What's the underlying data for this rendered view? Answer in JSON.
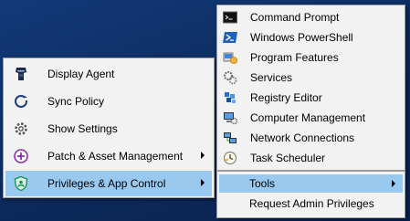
{
  "main_menu": {
    "items": [
      {
        "label": "Display Agent",
        "icon": "agent-icon"
      },
      {
        "label": "Sync Policy",
        "icon": "sync-icon"
      },
      {
        "label": "Show Settings",
        "icon": "gear-icon"
      },
      {
        "label": "Patch & Asset Management",
        "icon": "patch-icon",
        "has_submenu": true
      },
      {
        "label": "Privileges & App Control",
        "icon": "shield-icon",
        "has_submenu": true,
        "selected": true
      }
    ]
  },
  "tools_menu": {
    "items": [
      {
        "label": "Command Prompt",
        "icon": "command-prompt-icon"
      },
      {
        "label": "Windows PowerShell",
        "icon": "powershell-icon"
      },
      {
        "label": "Program  Features",
        "icon": "programs-icon"
      },
      {
        "label": "Services",
        "icon": "services-icon"
      },
      {
        "label": "Registry Editor",
        "icon": "registry-icon"
      },
      {
        "label": "Computer Management",
        "icon": "computer-management-icon"
      },
      {
        "label": "Network Connections",
        "icon": "network-icon"
      },
      {
        "label": "Task Scheduler",
        "icon": "scheduler-icon"
      }
    ]
  },
  "privileges_submenu": {
    "items": [
      {
        "label": "Tools",
        "has_submenu": true,
        "selected": true
      },
      {
        "label": "Request Admin Privileges"
      }
    ]
  },
  "colors": {
    "menu_bg": "#f2f2f2",
    "highlight": "#99c9ef",
    "desktop": "#0f2f63"
  }
}
